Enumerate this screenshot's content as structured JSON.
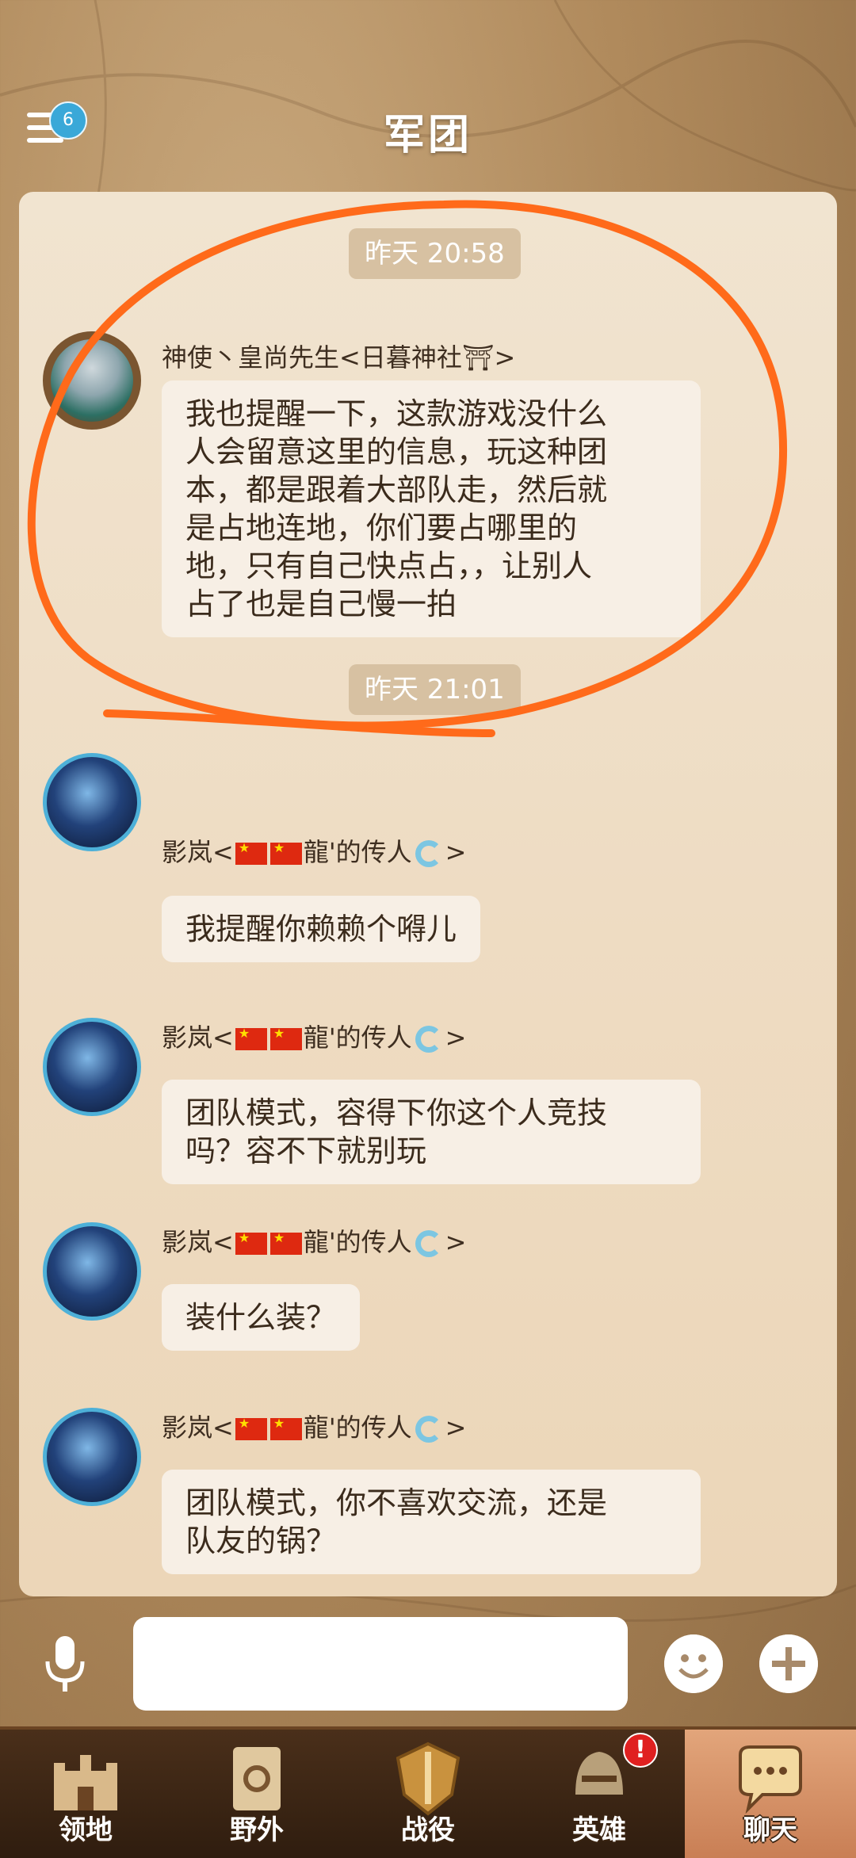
{
  "header": {
    "title": "军团",
    "menu_badge": "6"
  },
  "chat": {
    "timestamps": [
      "昨天 20:58",
      "昨天 21:01"
    ],
    "messages": [
      {
        "sender": "神使丶皇尚先生<日暮神社⛩>",
        "text": "我也提醒一下，这款游戏没什么\n人会留意这里的信息，玩这种团\n本，都是跟着大部队走，然后就\n是占地连地，你们要占哪里的\n地，只有自己快点占，，让别人\n占了也是自己慢一拍"
      },
      {
        "sender_prefix": "影岚<",
        "sender_name": "龍'的传人",
        "sender_suffix": ">",
        "text": "我提醒你赖赖个嘚儿"
      },
      {
        "sender_prefix": "影岚<",
        "sender_name": "龍'的传人",
        "sender_suffix": ">",
        "text": "团队模式，容得下你这个人竞技\n吗？容不下就别玩"
      },
      {
        "sender_prefix": "影岚<",
        "sender_name": "龍'的传人",
        "sender_suffix": ">",
        "text": "装什么装？"
      },
      {
        "sender_prefix": "影岚<",
        "sender_name": "龍'的传人",
        "sender_suffix": ">",
        "text": "团队模式，你不喜欢交流，还是\n队友的锅？"
      }
    ]
  },
  "input": {
    "placeholder": ""
  },
  "nav": {
    "items": [
      {
        "label": "领地",
        "icon": "castle-icon"
      },
      {
        "label": "野外",
        "icon": "scroll-map-icon"
      },
      {
        "label": "战役",
        "icon": "sword-shield-icon"
      },
      {
        "label": "英雄",
        "icon": "helmet-icon",
        "badge": "!"
      },
      {
        "label": "聊天",
        "icon": "chat-bubble-icon",
        "active": true
      }
    ]
  },
  "colors": {
    "annotation": "#ff6a1a",
    "accent_badge": "#3aa8d8"
  }
}
